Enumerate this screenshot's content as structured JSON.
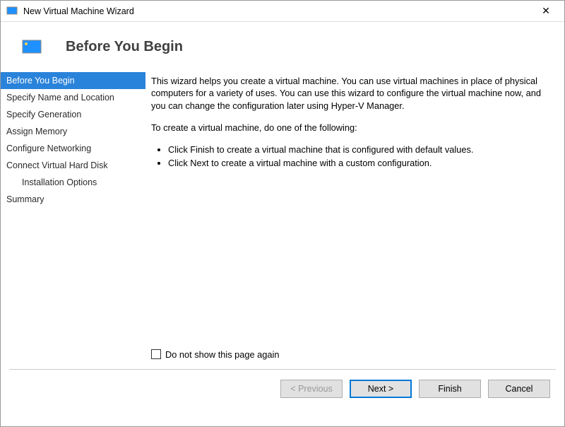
{
  "window": {
    "title": "New Virtual Machine Wizard"
  },
  "header": {
    "title": "Before You Begin"
  },
  "nav": {
    "items": [
      {
        "label": "Before You Begin",
        "selected": true
      },
      {
        "label": "Specify Name and Location"
      },
      {
        "label": "Specify Generation"
      },
      {
        "label": "Assign Memory"
      },
      {
        "label": "Configure Networking"
      },
      {
        "label": "Connect Virtual Hard Disk"
      },
      {
        "label": "Installation Options",
        "indent": true
      },
      {
        "label": "Summary"
      }
    ]
  },
  "content": {
    "para1": "This wizard helps you create a virtual machine. You can use virtual machines in place of physical computers for a variety of uses. You can use this wizard to configure the virtual machine now, and you can change the configuration later using Hyper-V Manager.",
    "para2": "To create a virtual machine, do one of the following:",
    "bullet1": "Click Finish to create a virtual machine that is configured with default values.",
    "bullet2": "Click Next to create a virtual machine with a custom configuration.",
    "checkbox_label": "Do not show this page again"
  },
  "buttons": {
    "previous": "< Previous",
    "next": "Next >",
    "finish": "Finish",
    "cancel": "Cancel"
  }
}
